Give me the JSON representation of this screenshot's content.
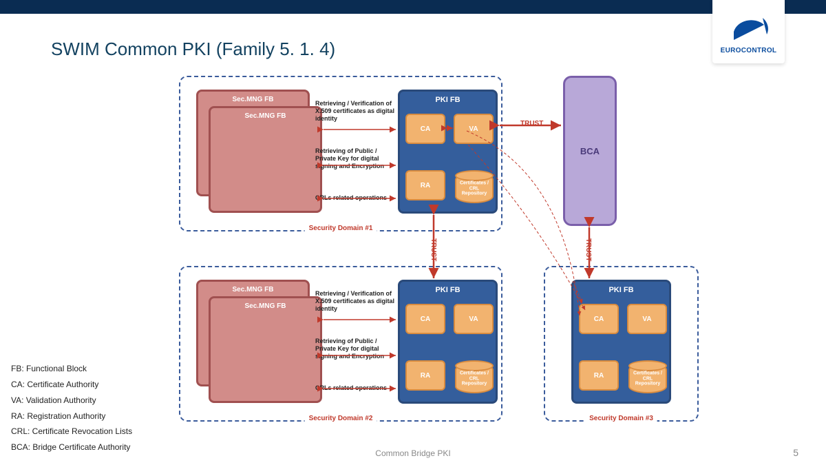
{
  "header": {
    "title": "SWIM Common PKI (Family 5. 1. 4)",
    "logo_text": "EUROCONTROL"
  },
  "domains": {
    "d1": {
      "label": "Security Domain #1"
    },
    "d2": {
      "label": "Security Domain #2"
    },
    "d3": {
      "label": "Security Domain #3"
    }
  },
  "blocks": {
    "smfb": "Sec.MNG FB",
    "pki_fb": "PKI  FB",
    "ca": "CA",
    "va": "VA",
    "ra": "RA",
    "repo": "Certificates / CRL Repository",
    "bca": "BCA"
  },
  "trust": {
    "label": "TRUST"
  },
  "notes": {
    "n1": "Retrieving / Verification of X.509 certificates as digital identity",
    "n2": "Retrieving of Public / Private Key for digital signing and Encryption",
    "n3": "CRLs related operations"
  },
  "legend": {
    "l1": "FB: Functional Block",
    "l2": "CA: Certificate Authority",
    "l3": "VA: Validation Authority",
    "l4": "RA: Registration Authority",
    "l5": "CRL: Certificate Revocation Lists",
    "l6": "BCA: Bridge Certificate Authority"
  },
  "footer": {
    "text": "Common Bridge PKI",
    "page": "5"
  }
}
